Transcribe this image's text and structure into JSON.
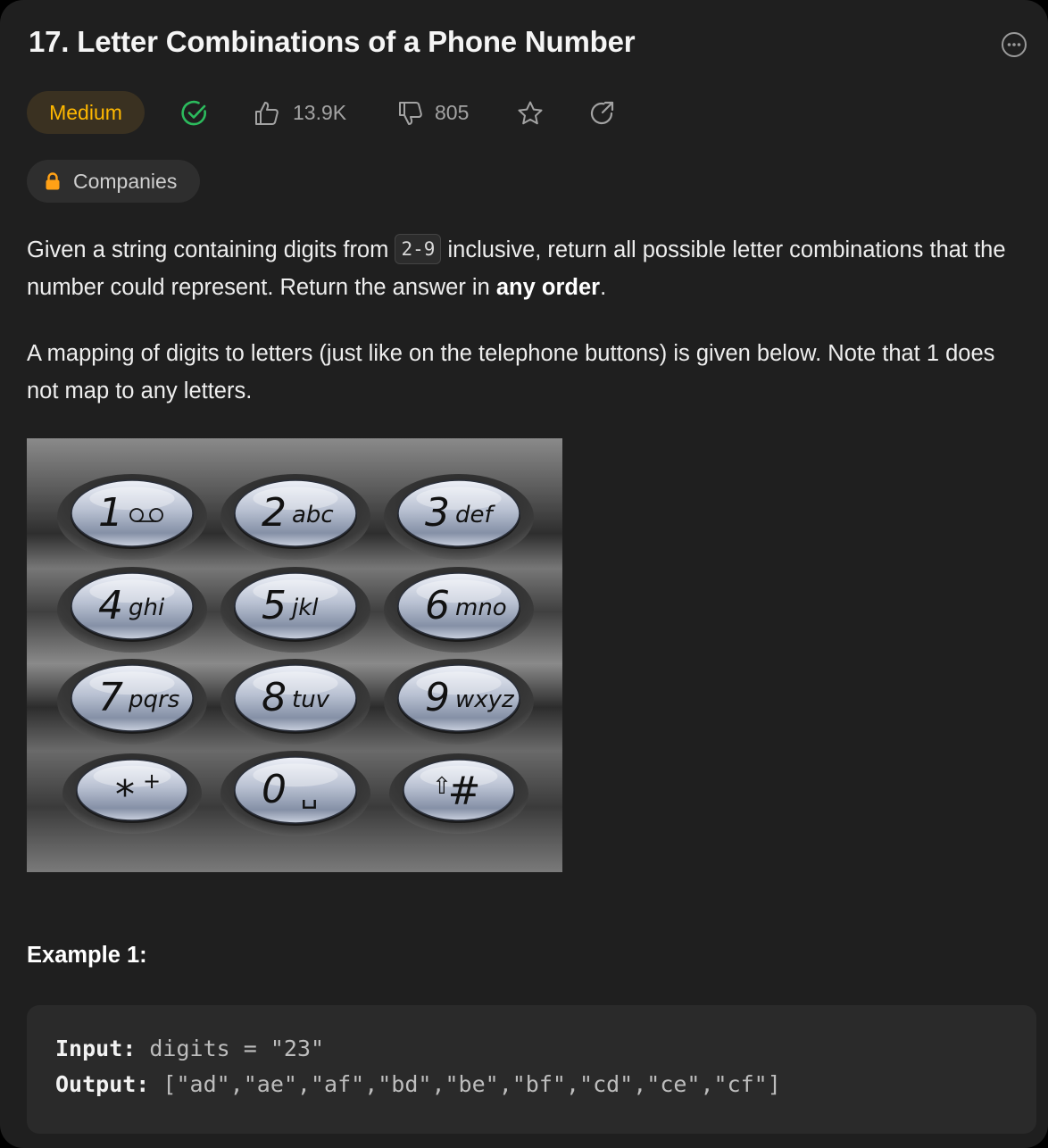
{
  "problem": {
    "title": "17. Letter Combinations of a Phone Number",
    "difficulty": "Medium",
    "likes": "13.9K",
    "dislikes": "805",
    "companies_label": "Companies"
  },
  "description": {
    "p1_before": "Given a string containing digits from ",
    "p1_code": "2-9",
    "p1_after": " inclusive, return all possible letter combinations that the number could represent. Return the answer in ",
    "p1_bold": "any order",
    "p1_end": ".",
    "p2": "A mapping of digits to letters (just like on the telephone buttons) is given below. Note that 1 does not map to any letters."
  },
  "keypad": {
    "keys": [
      {
        "digit": "1",
        "letters": ""
      },
      {
        "digit": "2",
        "letters": "abc"
      },
      {
        "digit": "3",
        "letters": "def"
      },
      {
        "digit": "4",
        "letters": "ghi"
      },
      {
        "digit": "5",
        "letters": "jkl"
      },
      {
        "digit": "6",
        "letters": "mno"
      },
      {
        "digit": "7",
        "letters": "pqrs"
      },
      {
        "digit": "8",
        "letters": "tuv"
      },
      {
        "digit": "9",
        "letters": "wxyz"
      },
      {
        "digit": "*",
        "letters": "+"
      },
      {
        "digit": "0",
        "letters": "␣"
      },
      {
        "digit": "#",
        "letters": "⇧"
      }
    ]
  },
  "example": {
    "title": "Example 1:",
    "input_label": "Input:",
    "input_value": "digits = \"23\"",
    "output_label": "Output:",
    "output_value": "[\"ad\",\"ae\",\"af\",\"bd\",\"be\",\"bf\",\"cd\",\"ce\",\"cf\"]"
  },
  "colors": {
    "background": "#1f1f1f",
    "difficulty_medium": "#ffb800",
    "solved_check": "#2cbb5d",
    "lock": "#ffa116"
  },
  "icons": [
    "more-icon",
    "solved-check-icon",
    "thumbs-up-icon",
    "thumbs-down-icon",
    "star-icon",
    "share-icon",
    "lock-icon"
  ]
}
